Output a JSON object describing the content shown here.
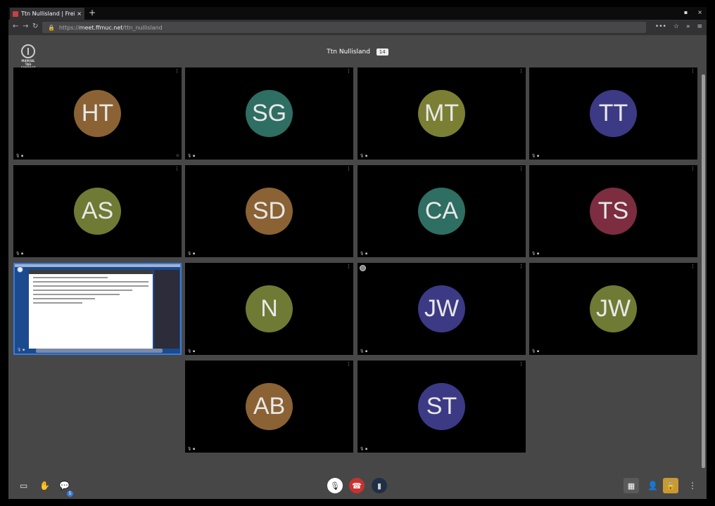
{
  "browser": {
    "tab_title": "Ttn Nullisland | Freifu",
    "tab_close": "×",
    "new_tab": "+",
    "url_secure": "🔒",
    "url_host": "meet.ffmuc.net",
    "url_prefix": "https://",
    "url_path": "/ttn_nullisland",
    "win_min": "▪",
    "win_close": "×",
    "back": "←",
    "forward": "→",
    "reload": "↻",
    "menu_dots": "•••",
    "bookmark": "☆",
    "hamburger": "≡",
    "overflow": "»"
  },
  "meeting": {
    "logo_text": "MANUAL TAG CONTACT",
    "room_name": "Ttn Nullisland",
    "participant_count": "14",
    "participants": [
      {
        "initials": "HT",
        "color": "#8a6234"
      },
      {
        "initials": "SG",
        "color": "#2f6e62"
      },
      {
        "initials": "MT",
        "color": "#7a7f34"
      },
      {
        "initials": "TT",
        "color": "#3c3a85"
      },
      {
        "initials": "AS",
        "color": "#6f7a34"
      },
      {
        "initials": "SD",
        "color": "#8a6234"
      },
      {
        "initials": "CA",
        "color": "#2f6e62"
      },
      {
        "initials": "TS",
        "color": "#7c2d40"
      },
      {
        "initials": "N",
        "color": "#6f7a34"
      },
      {
        "initials": "JW",
        "color": "#3c3a85"
      },
      {
        "initials": "JW",
        "color": "#6f7a34"
      },
      {
        "initials": "AB",
        "color": "#8a6234"
      },
      {
        "initials": "ST",
        "color": "#3c3a85"
      }
    ],
    "tile_menu": "⋮",
    "tile_status": "🎙 ▪",
    "tile_star": "☆"
  },
  "toolbar": {
    "screen": "▭",
    "hand": "✋",
    "chat": "💬",
    "chat_count": "5",
    "mic": "🎙",
    "hangup": "☎",
    "camera": "▮",
    "tiles": "▦",
    "invite": "👤",
    "security": "🔒",
    "more": "⋮"
  }
}
